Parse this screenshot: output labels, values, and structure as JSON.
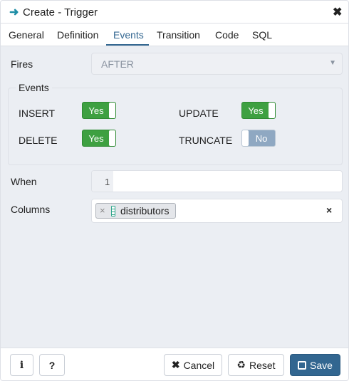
{
  "title": "Create - Trigger",
  "tabs": [
    "General",
    "Definition",
    "Events",
    "Transition",
    "Code",
    "SQL"
  ],
  "active_tab": "Events",
  "fires": {
    "label": "Fires",
    "value": "AFTER"
  },
  "events": {
    "legend": "Events",
    "insert": {
      "label": "INSERT",
      "value": "Yes"
    },
    "update": {
      "label": "UPDATE",
      "value": "Yes"
    },
    "delete": {
      "label": "DELETE",
      "value": "Yes"
    },
    "truncate": {
      "label": "TRUNCATE",
      "value": "No"
    }
  },
  "when": {
    "label": "When",
    "line_number": "1",
    "value": ""
  },
  "columns": {
    "label": "Columns",
    "tags": [
      "distributors"
    ]
  },
  "footer": {
    "info": "i",
    "help": "?",
    "cancel": "Cancel",
    "reset": "Reset",
    "save": "Save"
  },
  "colors": {
    "accent": "#326690",
    "toggle_on": "#3ea041",
    "toggle_off": "#8fa8c2",
    "save": "#326690"
  }
}
